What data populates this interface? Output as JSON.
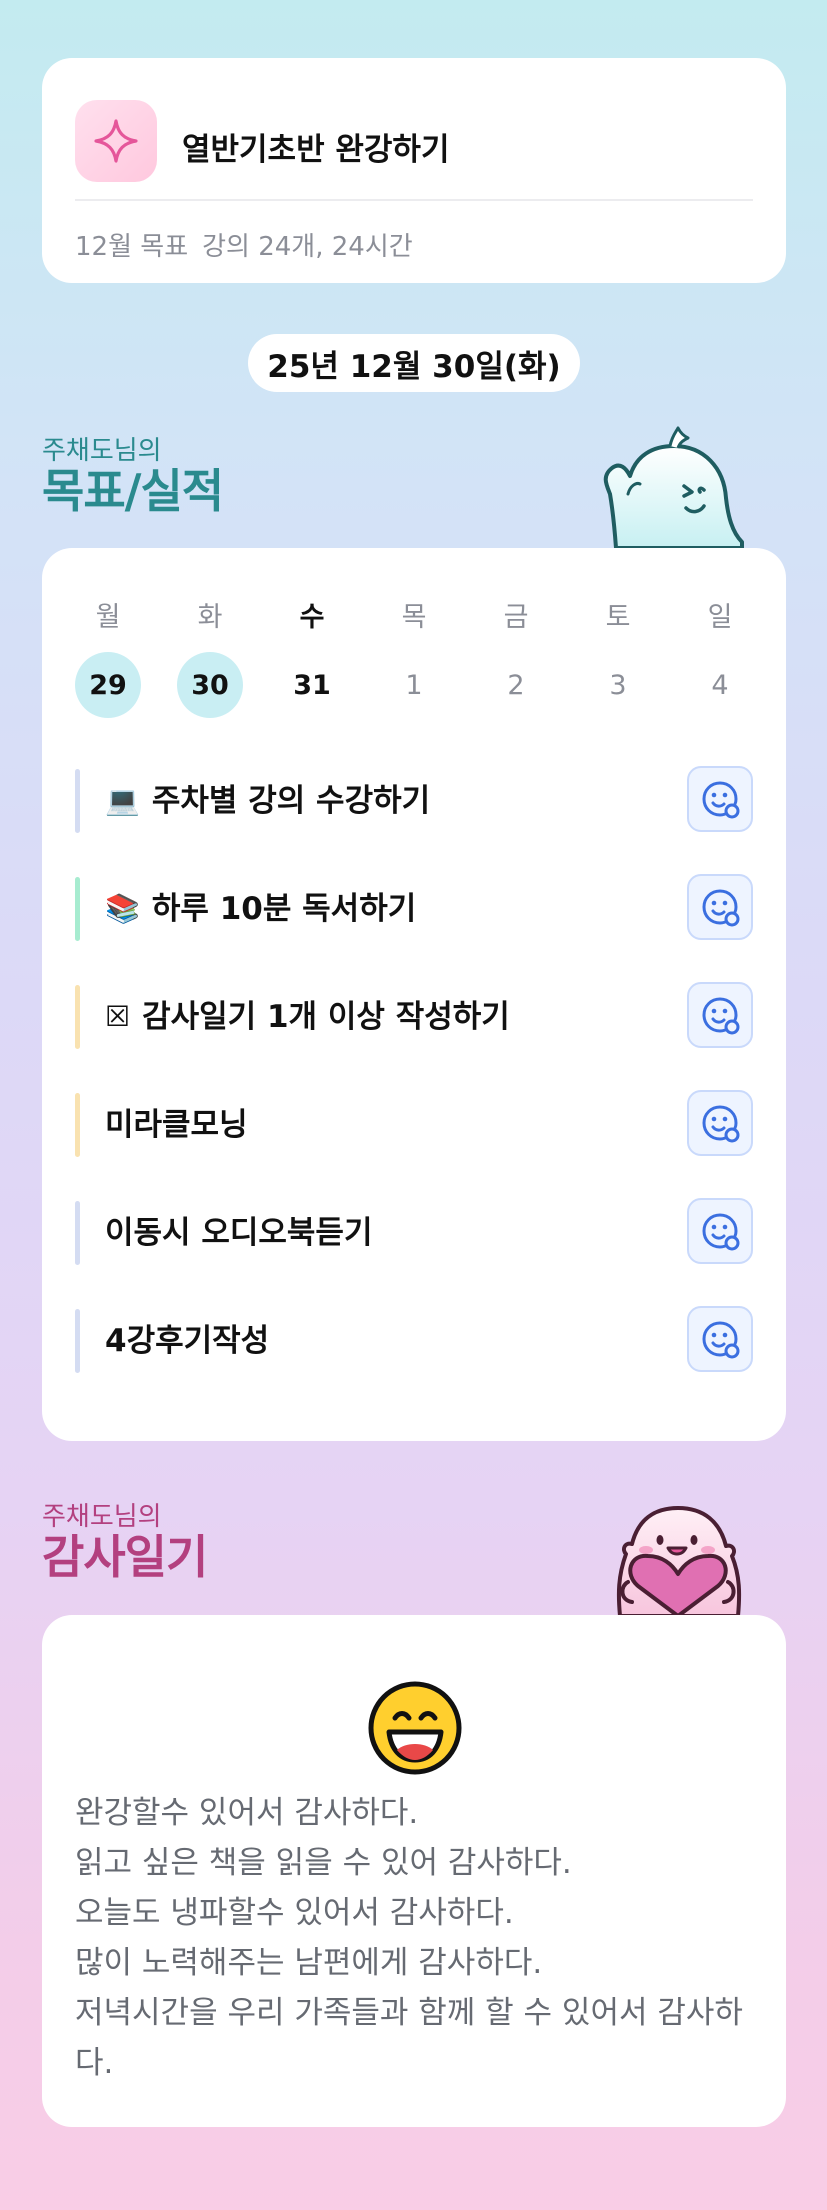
{
  "goal": {
    "icon": "sparkle-icon",
    "title": "열반기초반 완강하기",
    "month_label": "12월 목표",
    "detail": "강의 24개, 24시간"
  },
  "date": "25년 12월 30일(화)",
  "goal_section": {
    "subtitle": "주채도님의",
    "title": "목표/실적"
  },
  "week": {
    "days": [
      {
        "label": "월",
        "num": "29",
        "state": "done"
      },
      {
        "label": "화",
        "num": "30",
        "state": "done"
      },
      {
        "label": "수",
        "num": "31",
        "state": "today"
      },
      {
        "label": "목",
        "num": "1",
        "state": "future"
      },
      {
        "label": "금",
        "num": "2",
        "state": "future"
      },
      {
        "label": "토",
        "num": "3",
        "state": "future"
      },
      {
        "label": "일",
        "num": "4",
        "state": "future"
      }
    ]
  },
  "tasks": [
    {
      "emoji": "💻",
      "label": "주차별 강의 수강하기",
      "color": "#d4dcf2"
    },
    {
      "emoji": "📚",
      "label": "하루 10분 독서하기",
      "color": "#a7ecd0"
    },
    {
      "emoji": "☒",
      "label": "감사일기 1개 이상 작성하기",
      "color": "#f9e2b0"
    },
    {
      "emoji": "",
      "label": "미라클모닝",
      "color": "#f9e2b0"
    },
    {
      "emoji": "",
      "label": "이동시 오디오북듣기",
      "color": "#d4dcf2"
    },
    {
      "emoji": "",
      "label": "4강후기작성",
      "color": "#d4dcf2"
    }
  ],
  "task_button_icon": "smiley-check-icon",
  "gratitude_section": {
    "subtitle": "주채도님의",
    "title": "감사일기"
  },
  "gratitude": {
    "mood_icon": "grinning-face-icon",
    "lines": [
      "완강할수 있어서 감사하다.",
      "읽고 싶은 책을 읽을 수 있어 감사하다.",
      "오늘도 냉파할수 있어서 감사하다.",
      "많이 노력해주는 남편에게 감사하다.",
      "저녁시간을 우리 가족들과 함께 할 수 있어서 감사하다."
    ]
  },
  "colors": {
    "goal_accent": "#2a8a8e",
    "gratitude_accent": "#b3407f",
    "done_day": "#c9eef3",
    "button_bg": "#eef4ff",
    "button_icon": "#3b6fe0"
  }
}
